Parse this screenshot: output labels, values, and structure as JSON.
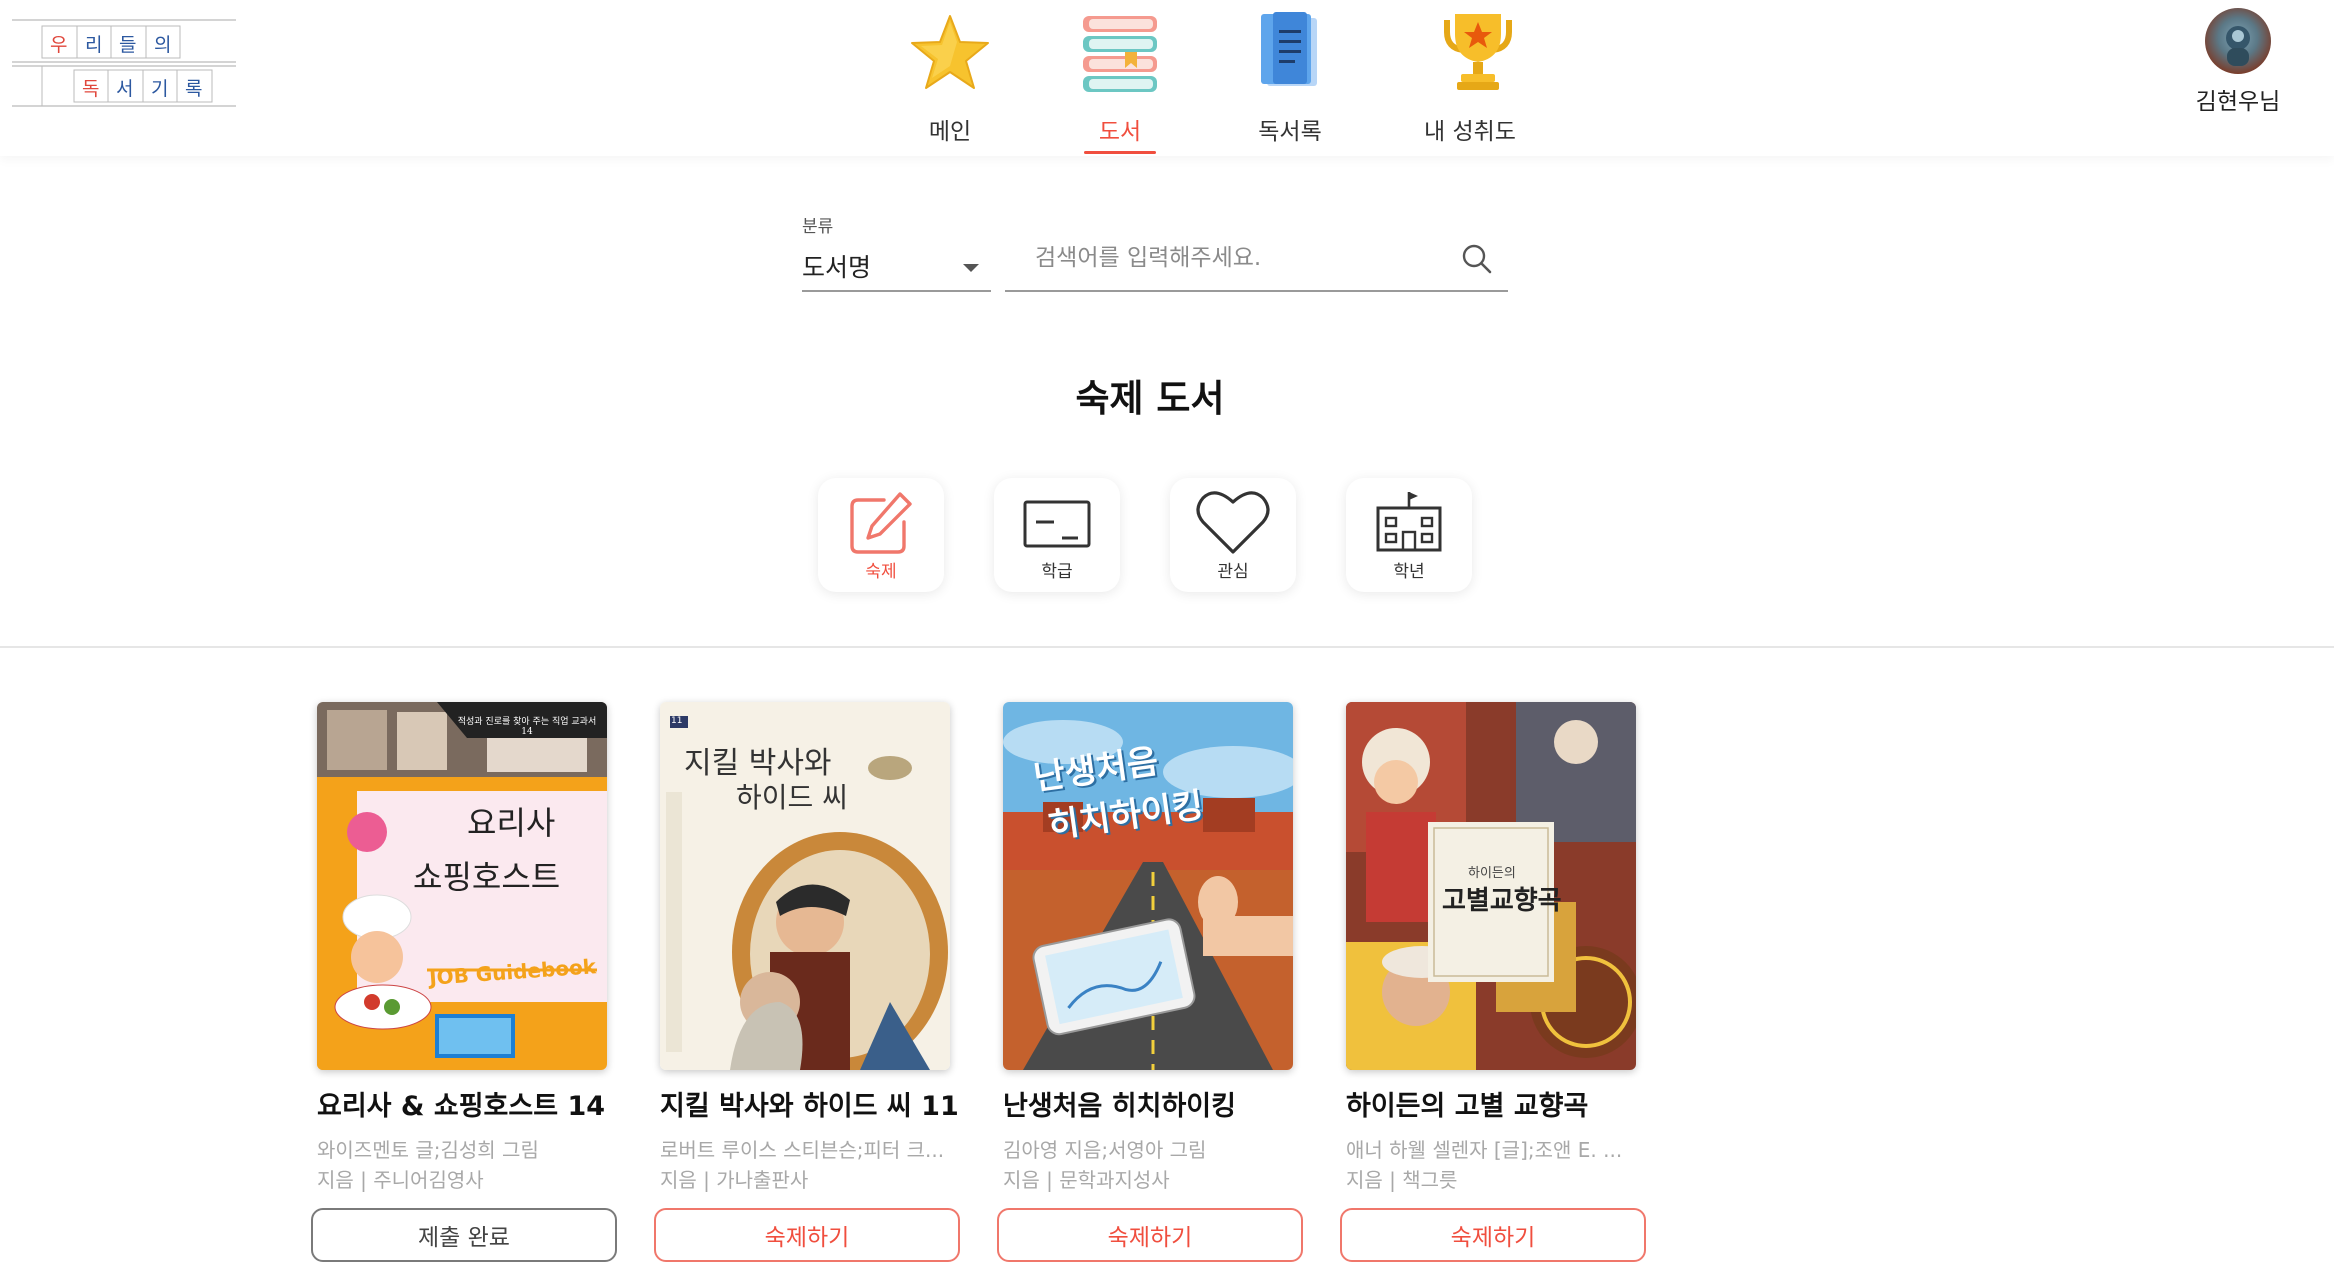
{
  "logo": {
    "row1": [
      "우",
      "리",
      "들",
      "의"
    ],
    "row2": [
      "독",
      "서",
      "기",
      "록"
    ]
  },
  "nav": [
    {
      "label": "메인",
      "icon": "star-icon",
      "active": false
    },
    {
      "label": "도서",
      "icon": "books-stack-icon",
      "active": true
    },
    {
      "label": "독서록",
      "icon": "document-icon",
      "active": false
    },
    {
      "label": "내 성취도",
      "icon": "trophy-icon",
      "active": false
    }
  ],
  "user": {
    "name": "김현우님"
  },
  "search": {
    "category_caption": "분류",
    "category_value": "도서명",
    "placeholder": "검색어를 입력해주세요."
  },
  "section_title": "숙제 도서",
  "categories": [
    {
      "label": "숙제",
      "icon": "edit-icon",
      "active": true
    },
    {
      "label": "학급",
      "icon": "blackboard-icon",
      "active": false
    },
    {
      "label": "관심",
      "icon": "heart-icon",
      "active": false
    },
    {
      "label": "학년",
      "icon": "school-icon",
      "active": false
    }
  ],
  "books": [
    {
      "title": "요리사 & 쇼핑호스트 14",
      "author": "와이즈멘토 글;김성희 그림",
      "publisher": "지음 | 주니어김영사",
      "button": "제출 완료",
      "status": "done",
      "cover_lines": [
        "요리사",
        "쇼핑호스트"
      ],
      "cover_banner": "적성과 진로를 찾아 주는 직업 교과서 14",
      "cover_sub": "JOB Guidebook"
    },
    {
      "title": "지킬 박사와 하이드 씨 11",
      "author": "로버트 루이스 스티븐슨;피터 크...",
      "publisher": "지음 | 가나출판사",
      "button": "숙제하기",
      "status": "todo",
      "cover_lines": [
        "지킬 박사와",
        "하이드 씨"
      ],
      "cover_banner": "11",
      "cover_sub": ""
    },
    {
      "title": "난생처음 히치하이킹",
      "author": "김아영 지음;서영아 그림",
      "publisher": "지음 | 문학과지성사",
      "button": "숙제하기",
      "status": "todo",
      "cover_lines": [
        "난생처음",
        "히치하이킹"
      ],
      "cover_banner": "",
      "cover_sub": ""
    },
    {
      "title": "하이든의 고별 교향곡",
      "author": "애너 하웰 셀렌자 [글];조앤 E. ...",
      "publisher": "지음 | 책그릇",
      "button": "숙제하기",
      "status": "todo",
      "cover_lines": [
        "하이든의",
        "고별교향곡"
      ],
      "cover_banner": "",
      "cover_sub": ""
    }
  ],
  "colors": {
    "accent": "#f04e3e",
    "muted": "#a8a8a8"
  }
}
